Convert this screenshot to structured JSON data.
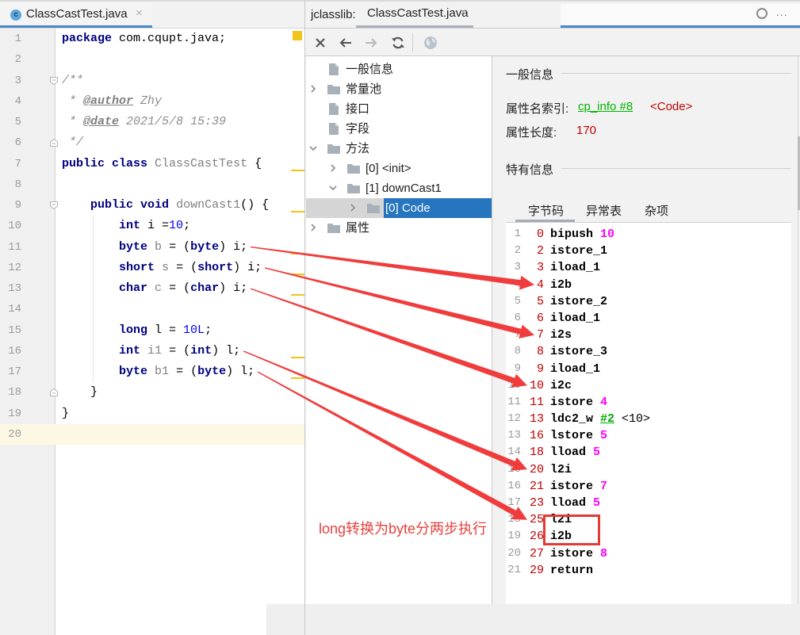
{
  "editor": {
    "tab": {
      "label": "ClassCastTest.java",
      "icon_letter": "c",
      "close": "×"
    },
    "current_line": 20,
    "warning_lines": [
      7,
      9,
      11,
      12,
      13,
      16,
      17
    ],
    "folds": {
      "3": "open",
      "6": "close",
      "9": "open",
      "18": "close"
    },
    "lines": [
      [
        [
          "kw",
          "package"
        ],
        [
          "t",
          " com.cqupt.java;"
        ]
      ],
      [],
      [
        [
          "cm",
          "/**"
        ]
      ],
      [
        [
          "cm",
          " * "
        ],
        [
          "tag",
          "@author"
        ],
        [
          "cm",
          " Zhy"
        ]
      ],
      [
        [
          "cm",
          " * "
        ],
        [
          "tag",
          "@date"
        ],
        [
          "cm",
          " 2021/5/8 15:39"
        ]
      ],
      [
        [
          "cm",
          " */"
        ]
      ],
      [
        [
          "kw",
          "public class"
        ],
        [
          "t",
          " "
        ],
        [
          "un",
          "ClassCastTest"
        ],
        [
          "t",
          " {"
        ]
      ],
      [],
      [
        [
          "t",
          "    "
        ],
        [
          "kw",
          "public void"
        ],
        [
          "t",
          " "
        ],
        [
          "un",
          "downCast1"
        ],
        [
          "t",
          "() {"
        ]
      ],
      [
        [
          "t",
          "        "
        ],
        [
          "kw",
          "int"
        ],
        [
          "t",
          " i ="
        ],
        [
          "num",
          "10"
        ],
        [
          "t",
          ";"
        ]
      ],
      [
        [
          "t",
          "        "
        ],
        [
          "kw",
          "byte"
        ],
        [
          "t",
          " "
        ],
        [
          "un",
          "b"
        ],
        [
          "t",
          " = ("
        ],
        [
          "kw",
          "byte"
        ],
        [
          "t",
          ") i;"
        ]
      ],
      [
        [
          "t",
          "        "
        ],
        [
          "kw",
          "short"
        ],
        [
          "t",
          " "
        ],
        [
          "un",
          "s"
        ],
        [
          "t",
          " = ("
        ],
        [
          "kw",
          "short"
        ],
        [
          "t",
          ") i;"
        ]
      ],
      [
        [
          "t",
          "        "
        ],
        [
          "kw",
          "char"
        ],
        [
          "t",
          " "
        ],
        [
          "un",
          "c"
        ],
        [
          "t",
          " = ("
        ],
        [
          "kw",
          "char"
        ],
        [
          "t",
          ") i;"
        ]
      ],
      [],
      [
        [
          "t",
          "        "
        ],
        [
          "kw",
          "long"
        ],
        [
          "t",
          " l = "
        ],
        [
          "num",
          "10L"
        ],
        [
          "t",
          ";"
        ]
      ],
      [
        [
          "t",
          "        "
        ],
        [
          "kw",
          "int"
        ],
        [
          "t",
          " "
        ],
        [
          "un",
          "i1"
        ],
        [
          "t",
          " = ("
        ],
        [
          "kw",
          "int"
        ],
        [
          "t",
          ") l;"
        ]
      ],
      [
        [
          "t",
          "        "
        ],
        [
          "kw",
          "byte"
        ],
        [
          "t",
          " "
        ],
        [
          "un",
          "b1"
        ],
        [
          "t",
          " = ("
        ],
        [
          "kw",
          "byte"
        ],
        [
          "t",
          ") l;"
        ]
      ],
      [
        [
          "t",
          "    }"
        ]
      ],
      [
        [
          "t",
          "}"
        ]
      ],
      []
    ]
  },
  "jclasslib": {
    "label": "jclasslib:",
    "tab": {
      "label": "ClassCastTest.java",
      "close": "×"
    },
    "float_toolbar": {
      "more": "..."
    },
    "toolbar": [
      {
        "icon": "close-icon",
        "enabled": true
      },
      {
        "icon": "back-arrow-icon",
        "enabled": true
      },
      {
        "icon": "forward-arrow-icon",
        "enabled": false
      },
      {
        "icon": "refresh-icon",
        "enabled": true
      },
      {
        "icon": "globe-icon",
        "enabled": false
      }
    ],
    "tree": [
      {
        "label": "一般信息",
        "level": 0,
        "icon": "file",
        "toggle": null
      },
      {
        "label": "常量池",
        "level": 0,
        "icon": "folder",
        "toggle": "collapsed"
      },
      {
        "label": "接口",
        "level": 0,
        "icon": "file",
        "toggle": null
      },
      {
        "label": "字段",
        "level": 0,
        "icon": "file",
        "toggle": null
      },
      {
        "label": "方法",
        "level": 0,
        "icon": "folder",
        "toggle": "expanded"
      },
      {
        "label": "[0] <init>",
        "level": 1,
        "icon": "folder",
        "toggle": "collapsed"
      },
      {
        "label": "[1] downCast1",
        "level": 1,
        "icon": "folder",
        "toggle": "expanded"
      },
      {
        "label": "[0] Code",
        "level": 2,
        "icon": "folder",
        "toggle": "collapsed",
        "selected": true
      },
      {
        "label": "属性",
        "level": 0,
        "icon": "folder",
        "toggle": "collapsed"
      }
    ],
    "detail": {
      "general_header": "一般信息",
      "name_index_label": "属性名索引:",
      "name_index_link": "cp_info #8",
      "name_index_value": "<Code>",
      "length_label": "属性长度:",
      "length_value": "170",
      "specific_header": "特有信息",
      "tabs": [
        "字节码",
        "异常表",
        "杂项"
      ],
      "active_tab": 0,
      "bytecode": [
        {
          "n": "1",
          "off": "0",
          "op": "bipush",
          "arg": "10"
        },
        {
          "n": "2",
          "off": "2",
          "op": "istore_1"
        },
        {
          "n": "3",
          "off": "3",
          "op": "iload_1"
        },
        {
          "n": "4",
          "off": "4",
          "op": "i2b"
        },
        {
          "n": "5",
          "off": "5",
          "op": "istore_2"
        },
        {
          "n": "6",
          "off": "6",
          "op": "iload_1"
        },
        {
          "n": "7",
          "off": "7",
          "op": "i2s"
        },
        {
          "n": "8",
          "off": "8",
          "op": "istore_3"
        },
        {
          "n": "9",
          "off": "9",
          "op": "iload_1"
        },
        {
          "n": "10",
          "off": "10",
          "op": "i2c"
        },
        {
          "n": "11",
          "off": "11",
          "op": "istore",
          "arg": "4"
        },
        {
          "n": "12",
          "off": "13",
          "op": "ldc2_w",
          "ref": "#2",
          "extra": "<10>"
        },
        {
          "n": "13",
          "off": "16",
          "op": "lstore",
          "arg": "5"
        },
        {
          "n": "14",
          "off": "18",
          "op": "lload",
          "arg": "5"
        },
        {
          "n": "15",
          "off": "20",
          "op": "l2i"
        },
        {
          "n": "16",
          "off": "21",
          "op": "istore",
          "arg": "7"
        },
        {
          "n": "17",
          "off": "23",
          "op": "lload",
          "arg": "5"
        },
        {
          "n": "18",
          "off": "25",
          "op": "l2i"
        },
        {
          "n": "19",
          "off": "26",
          "op": "i2b"
        },
        {
          "n": "20",
          "off": "27",
          "op": "istore",
          "arg": "8"
        },
        {
          "n": "21",
          "off": "29",
          "op": "return"
        }
      ]
    }
  },
  "annotations": {
    "note": "long转换为byte分两步执行",
    "color": "#f03c3c",
    "arrows": [
      {
        "from_code_line": 11,
        "to_bytecode_line": 4
      },
      {
        "from_code_line": 12,
        "to_bytecode_line": 7
      },
      {
        "from_code_line": 13,
        "to_bytecode_line": 10
      },
      {
        "from_code_line": 16,
        "to_bytecode_line": 15
      },
      {
        "from_code_line": 17,
        "to_bytecode_line": 18
      }
    ],
    "highlight_bytecode_lines": [
      18,
      19
    ]
  }
}
